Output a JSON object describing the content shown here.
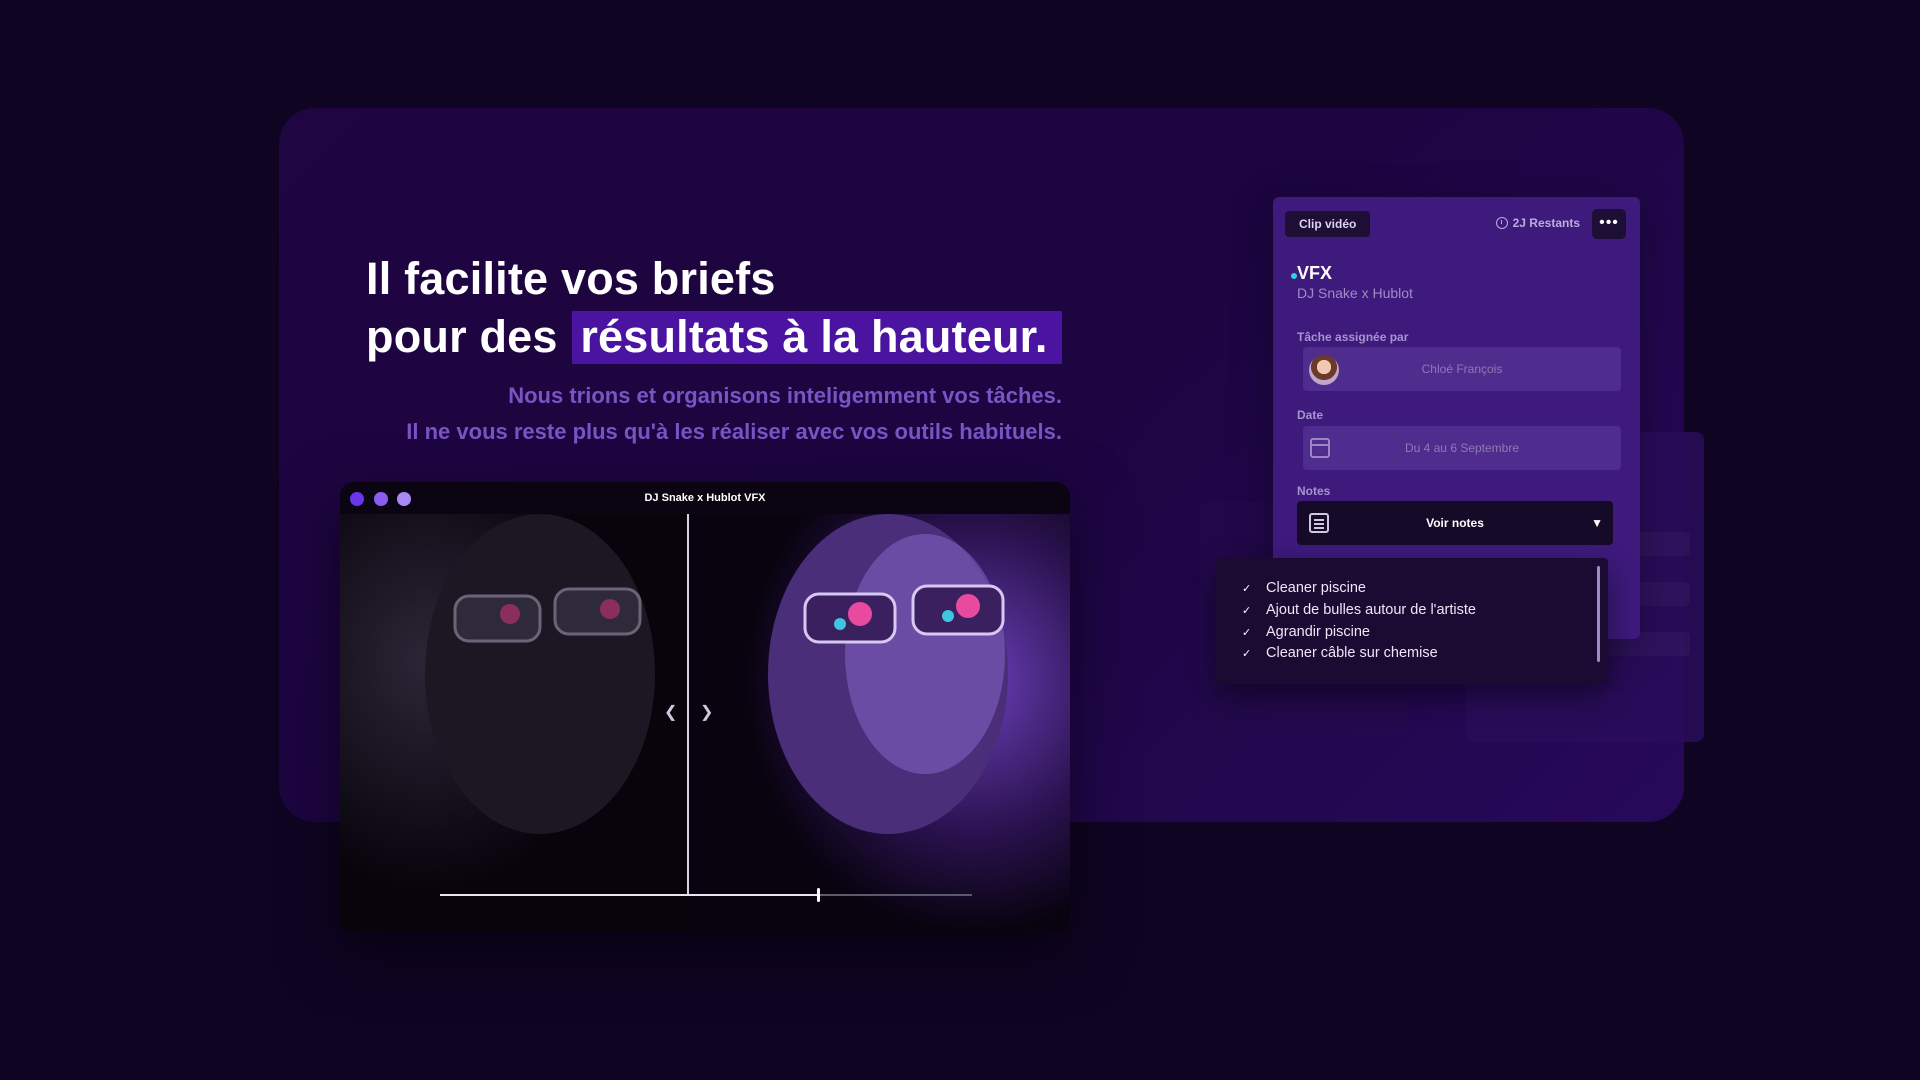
{
  "headline": {
    "line1": "Il facilite vos briefs",
    "line2_prefix": "pour des",
    "line2_highlight": "résultats à la hauteur."
  },
  "subtext": {
    "line1": "Nous trions et organisons inteligemment vos tâches.",
    "line2": "Il ne vous reste plus qu'à les réaliser avec vos outils habituels."
  },
  "video": {
    "title": "DJ Snake x Hublot VFX",
    "progress": 0.71
  },
  "card": {
    "chip": "Clip vidéo",
    "remaining": "2J Restants",
    "more": "•••",
    "title": "VFX",
    "subtitle": "DJ Snake x Hublot",
    "assigned_label": "Tâche assignée par",
    "assigned_value": "Chloé François",
    "date_label": "Date",
    "date_value": "Du 4 au 6 Septembre",
    "notes_label": "Notes",
    "notes_button": "Voir notes",
    "notes_caret": "▼"
  },
  "checklist": [
    "Cleaner piscine",
    "Ajout de bulles autour de l'artiste",
    "Agrandir piscine",
    "Cleaner câble sur chemise"
  ],
  "colors": {
    "background": "#0f0422",
    "accent": "#4a14a0",
    "dot1": "#6a35e8",
    "dot2": "#8a5df0",
    "dot3": "#a98af5"
  }
}
